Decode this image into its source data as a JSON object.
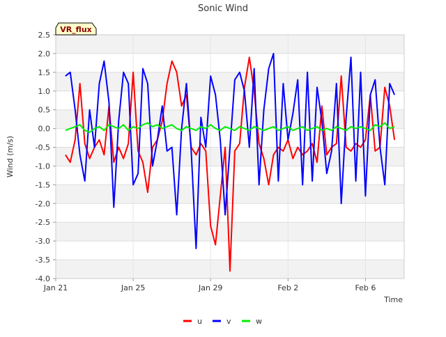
{
  "chart_data": {
    "type": "line",
    "title": "Sonic Wind",
    "xlabel": "Time",
    "ylabel": "Wind (m/s)",
    "ylim": [
      -4.0,
      2.5
    ],
    "xlim": [
      "2025-01-21",
      "2025-02-08"
    ],
    "x_ticks": [
      {
        "date": "2025-01-21",
        "label": "Jan 21"
      },
      {
        "date": "2025-01-25",
        "label": "Jan 25"
      },
      {
        "date": "2025-01-29",
        "label": "Jan 29"
      },
      {
        "date": "2025-02-02",
        "label": "Feb 2"
      },
      {
        "date": "2025-02-06",
        "label": "Feb 6"
      }
    ],
    "y_ticks": [
      -4.0,
      -3.5,
      -3.0,
      -2.5,
      -2.0,
      -1.5,
      -1.0,
      -0.5,
      0.0,
      0.5,
      1.0,
      1.5,
      2.0,
      2.5
    ],
    "y_tick_labels": [
      "-4.0",
      "-3.5",
      "-3.0",
      "-2.5",
      "-2.0",
      "-1.5",
      "-1.0",
      "-0.5",
      "0.0",
      "0.5",
      "1.0",
      "1.5",
      "2.0",
      "2.5"
    ],
    "grid": true,
    "background_bands": true,
    "legend_position": "bottom-center",
    "badge": {
      "text": "VR_flux",
      "fill": "#ffffcc",
      "text_color": "#8b0000"
    },
    "x": [
      "2025-01-21 12:00",
      "2025-01-21 18:00",
      "2025-01-22 00:00",
      "2025-01-22 06:00",
      "2025-01-22 12:00",
      "2025-01-22 18:00",
      "2025-01-23 00:00",
      "2025-01-23 06:00",
      "2025-01-23 12:00",
      "2025-01-23 18:00",
      "2025-01-24 00:00",
      "2025-01-24 06:00",
      "2025-01-24 12:00",
      "2025-01-24 18:00",
      "2025-01-25 00:00",
      "2025-01-25 06:00",
      "2025-01-25 12:00",
      "2025-01-25 18:00",
      "2025-01-26 00:00",
      "2025-01-26 06:00",
      "2025-01-26 12:00",
      "2025-01-26 18:00",
      "2025-01-27 00:00",
      "2025-01-27 06:00",
      "2025-01-27 12:00",
      "2025-01-27 18:00",
      "2025-01-28 00:00",
      "2025-01-28 06:00",
      "2025-01-28 12:00",
      "2025-01-28 18:00",
      "2025-01-29 00:00",
      "2025-01-29 06:00",
      "2025-01-29 12:00",
      "2025-01-29 18:00",
      "2025-01-30 00:00",
      "2025-01-30 06:00",
      "2025-01-30 12:00",
      "2025-01-30 18:00",
      "2025-01-31 00:00",
      "2025-01-31 06:00",
      "2025-01-31 12:00",
      "2025-01-31 18:00",
      "2025-02-01 00:00",
      "2025-02-01 06:00",
      "2025-02-01 12:00",
      "2025-02-01 18:00",
      "2025-02-02 00:00",
      "2025-02-02 06:00",
      "2025-02-02 12:00",
      "2025-02-02 18:00",
      "2025-02-03 00:00",
      "2025-02-03 06:00",
      "2025-02-03 12:00",
      "2025-02-03 18:00",
      "2025-02-04 00:00",
      "2025-02-04 06:00",
      "2025-02-04 12:00",
      "2025-02-04 18:00",
      "2025-02-05 00:00",
      "2025-02-05 06:00",
      "2025-02-05 12:00",
      "2025-02-05 18:00",
      "2025-02-06 00:00",
      "2025-02-06 06:00",
      "2025-02-06 12:00",
      "2025-02-06 18:00",
      "2025-02-07 00:00",
      "2025-02-07 06:00",
      "2025-02-07 12:00"
    ],
    "series": [
      {
        "name": "u",
        "color": "#ff0000",
        "values": [
          -0.7,
          -0.9,
          -0.3,
          1.2,
          -0.4,
          -0.8,
          -0.5,
          -0.3,
          -0.7,
          0.6,
          -0.9,
          -0.5,
          -0.8,
          -0.4,
          1.5,
          -0.6,
          -0.9,
          -1.7,
          -0.5,
          -0.3,
          0.2,
          1.2,
          1.8,
          1.5,
          0.6,
          0.9,
          -0.5,
          -0.7,
          -0.4,
          -0.6,
          -2.6,
          -3.1,
          -1.8,
          -0.5,
          -3.8,
          -0.6,
          -0.4,
          1.1,
          1.9,
          1.0,
          -0.4,
          -0.8,
          -1.5,
          -0.7,
          -0.5,
          -0.6,
          -0.3,
          -0.8,
          -0.5,
          -0.7,
          -0.6,
          -0.4,
          -0.9,
          0.6,
          -0.7,
          -0.5,
          -0.4,
          1.4,
          -0.5,
          -0.6,
          -0.4,
          -0.5,
          -0.3,
          0.9,
          -0.6,
          -0.5,
          1.1,
          0.6,
          -0.3
        ]
      },
      {
        "name": "v",
        "color": "#0000ff",
        "values": [
          1.4,
          1.5,
          0.5,
          -0.7,
          -1.4,
          0.5,
          -0.5,
          1.2,
          1.8,
          0.7,
          -2.1,
          0.2,
          1.5,
          1.2,
          -1.5,
          -1.2,
          1.6,
          1.2,
          -1.0,
          -0.3,
          0.6,
          -0.6,
          -0.5,
          -2.3,
          0.0,
          1.2,
          -0.6,
          -3.2,
          0.3,
          -0.5,
          1.4,
          0.9,
          -0.3,
          -2.3,
          -0.5,
          1.3,
          1.5,
          1.0,
          -0.5,
          1.6,
          -1.5,
          0.5,
          1.6,
          2.0,
          -1.4,
          1.2,
          -0.3,
          0.4,
          1.3,
          -1.5,
          1.5,
          -1.4,
          1.1,
          0.2,
          -1.2,
          -0.6,
          1.2,
          -2.0,
          0.3,
          1.9,
          -1.4,
          1.5,
          -1.8,
          0.9,
          1.3,
          -0.5,
          -1.5,
          1.2,
          0.9
        ]
      },
      {
        "name": "w",
        "color": "#00ee00",
        "values": [
          -0.05,
          0.0,
          0.05,
          0.1,
          -0.05,
          -0.1,
          0.0,
          0.05,
          -0.05,
          0.1,
          0.05,
          0.0,
          0.1,
          -0.05,
          0.05,
          0.0,
          0.1,
          0.15,
          0.05,
          0.1,
          0.0,
          0.05,
          0.1,
          0.0,
          -0.05,
          0.05,
          0.0,
          -0.05,
          0.05,
          0.0,
          0.1,
          0.0,
          -0.05,
          0.05,
          0.0,
          -0.05,
          0.05,
          0.0,
          -0.05,
          0.05,
          0.0,
          -0.05,
          0.0,
          0.05,
          -0.05,
          0.0,
          0.05,
          -0.05,
          0.0,
          0.05,
          -0.05,
          0.0,
          0.05,
          -0.05,
          0.0,
          -0.05,
          0.05,
          0.0,
          -0.05,
          0.05,
          0.0,
          0.05,
          0.0,
          -0.05,
          0.1,
          0.05,
          0.15,
          0.0,
          0.05
        ]
      }
    ]
  }
}
